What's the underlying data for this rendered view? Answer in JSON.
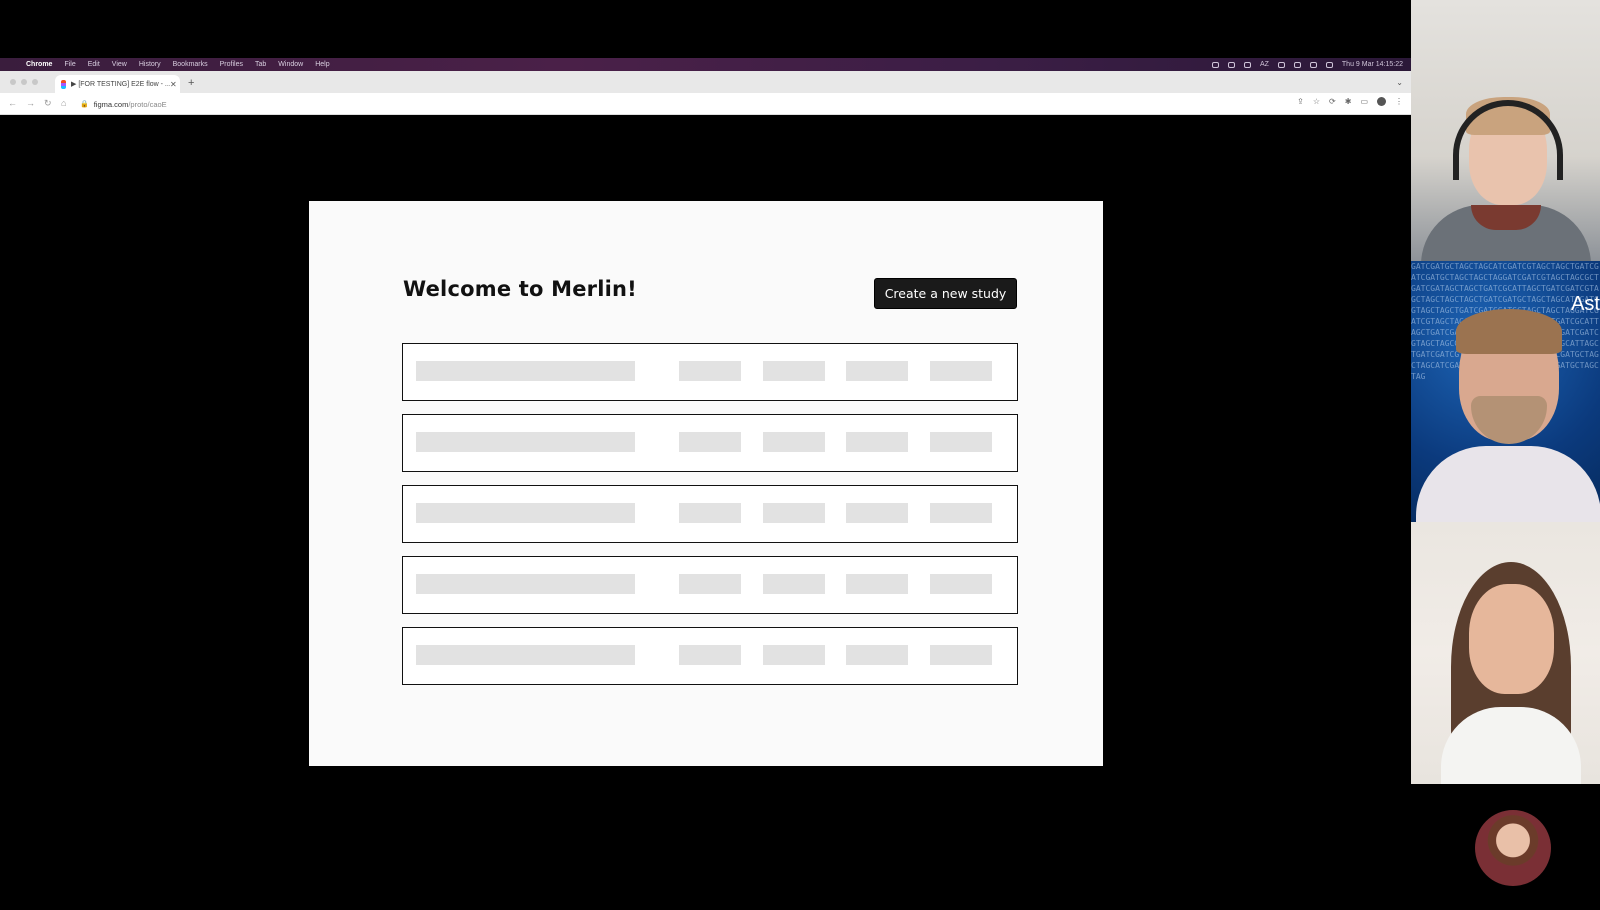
{
  "menubar": {
    "items": [
      "Chrome",
      "File",
      "Edit",
      "View",
      "History",
      "Bookmarks",
      "Profiles",
      "Tab",
      "Window",
      "Help"
    ],
    "clock": "Thu 9 Mar  14:15:22",
    "input_source": "AZ"
  },
  "browser": {
    "tab_title": "▶ [FOR TESTING] E2E flow - ...",
    "new_tab": "+",
    "url_host": "figma.com",
    "url_path": "/proto/caoE"
  },
  "prototype": {
    "heading": "Welcome to Merlin!",
    "create_button": "Create a new study",
    "row_count": 5
  },
  "participants": {
    "tile2_name": "Ast"
  },
  "colors": {
    "button_bg": "#1a1a1a",
    "placeholder": "#e2e2e2",
    "frame_bg": "#fafafa"
  }
}
